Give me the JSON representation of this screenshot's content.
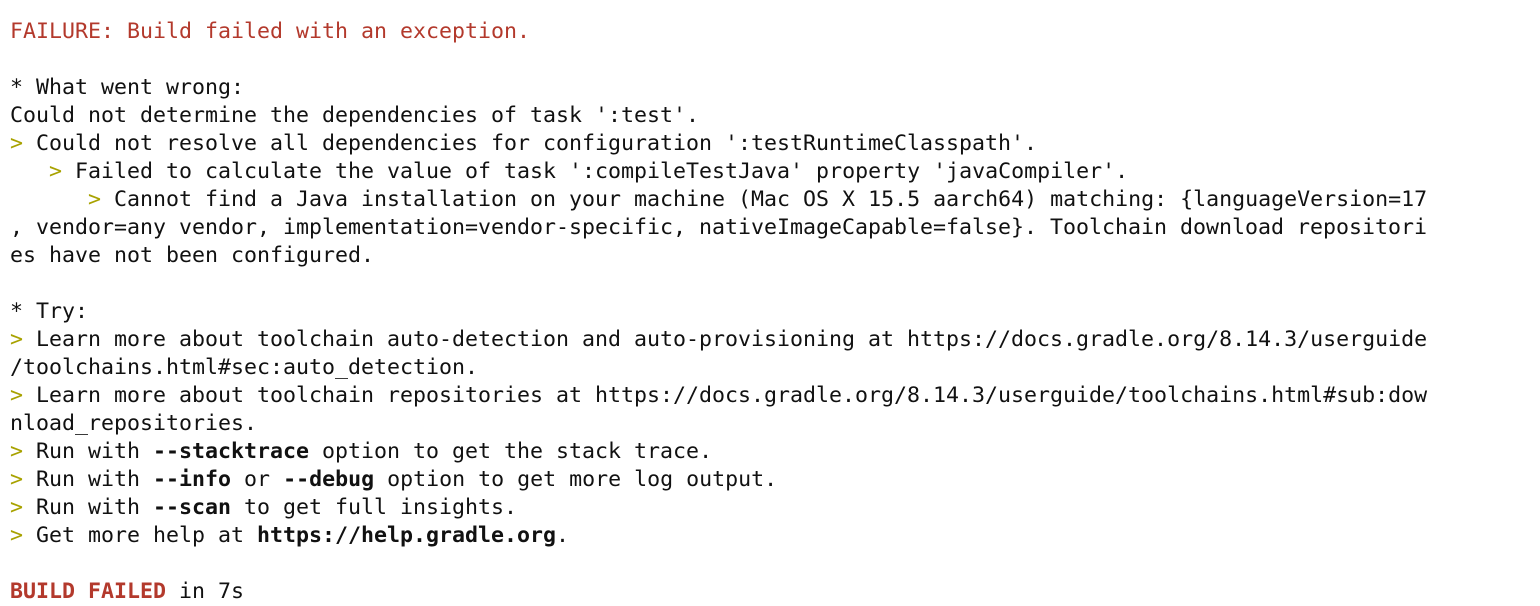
{
  "colors": {
    "error": "#b3392c",
    "prompt_marker": "#a8a200",
    "text": "#111111",
    "background": "#ffffff"
  },
  "lines": {
    "failure": "FAILURE: Build failed with an exception.",
    "what_went_wrong_header": "* What went wrong:",
    "wrong_1": "Could not determine the dependencies of task ':test'.",
    "marker_1": ">",
    "wrong_2": " Could not resolve all dependencies for configuration ':testRuntimeClasspath'.",
    "indent_2": "   ",
    "marker_2": ">",
    "wrong_3": " Failed to calculate the value of task ':compileTestJava' property 'javaCompiler'.",
    "indent_3": "      ",
    "marker_3": ">",
    "wrong_4": " Cannot find a Java installation on your machine (Mac OS X 15.5 aarch64) matching: {languageVersion=17",
    "wrong_5": ", vendor=any vendor, implementation=vendor-specific, nativeImageCapable=false}. Toolchain download repositori",
    "wrong_6": "es have not been configured.",
    "try_header": "* Try:",
    "marker_t1": ">",
    "try_1": " Learn more about toolchain auto-detection and auto-provisioning at https://docs.gradle.org/8.14.3/userguide",
    "try_1_cont": "/toolchains.html#sec:auto_detection.",
    "marker_t2": ">",
    "try_2": " Learn more about toolchain repositories at https://docs.gradle.org/8.14.3/userguide/toolchains.html#sub:dow",
    "try_2_cont": "nload_repositories.",
    "marker_t3": ">",
    "try_3_pre": " Run with ",
    "try_3_flag": "--stacktrace",
    "try_3_post": " option to get the stack trace.",
    "marker_t4": ">",
    "try_4_pre": " Run with ",
    "try_4_flag1": "--info",
    "try_4_mid": " or ",
    "try_4_flag2": "--debug",
    "try_4_post": " option to get more log output.",
    "marker_t5": ">",
    "try_5_pre": " Run with ",
    "try_5_flag": "--scan",
    "try_5_post": " to get full insights.",
    "marker_t6": ">",
    "try_6_pre": " Get more help at ",
    "try_6_link": "https://help.gradle.org",
    "try_6_post": ".",
    "build_failed": "BUILD FAILED",
    "build_time": " in 7s"
  }
}
